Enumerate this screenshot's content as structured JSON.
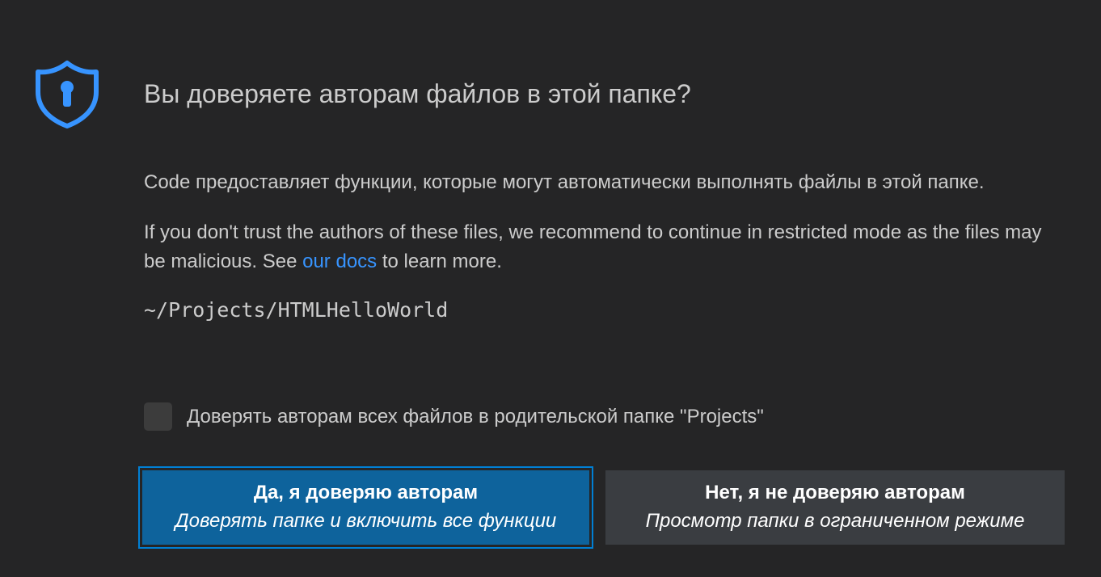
{
  "dialog": {
    "title": "Вы доверяете авторам файлов в этой папке?",
    "paragraph1": "Code предоставляет функции, которые могут автоматически выполнять файлы в этой папке.",
    "paragraph2_before": "If you don't trust the authors of these files, we recommend to continue in restricted mode as the files may be malicious. See ",
    "paragraph2_link": "our docs",
    "paragraph2_after": " to learn more.",
    "path": "~/Projects/HTMLHelloWorld",
    "checkbox_label": "Доверять авторам всех файлов в родительской папке \"Projects\"",
    "checkbox_checked": false
  },
  "buttons": {
    "trust": {
      "label": "Да, я доверяю авторам",
      "sublabel": "Доверять папке и включить все функции"
    },
    "restrict": {
      "label": "Нет, я не доверяю авторам",
      "sublabel": "Просмотр папки в ограниченном режиме"
    }
  },
  "icons": {
    "header": "shield-keyhole-icon"
  },
  "colors": {
    "background": "#252526",
    "text": "#cccccc",
    "accent": "#3794ff",
    "primary_button": "#0e639c",
    "primary_button_focus": "#007fd4",
    "secondary_button": "#3a3d41",
    "checkbox": "#3c3c3c"
  }
}
